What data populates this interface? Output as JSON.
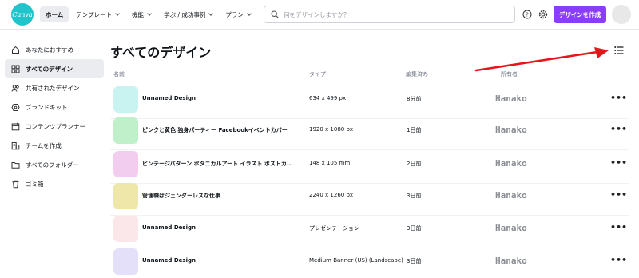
{
  "app": {
    "logo_text": "Canva"
  },
  "nav": {
    "items": [
      {
        "label": "ホーム",
        "active": true,
        "has_chevron": false
      },
      {
        "label": "テンプレート",
        "active": false,
        "has_chevron": true
      },
      {
        "label": "機能",
        "active": false,
        "has_chevron": true
      },
      {
        "label": "学ぶ / 成功事例",
        "active": false,
        "has_chevron": true
      },
      {
        "label": "プラン",
        "active": false,
        "has_chevron": true
      }
    ]
  },
  "search": {
    "placeholder": "何をデザインしますか？"
  },
  "header": {
    "create_label": "デザインを作成"
  },
  "sidebar": {
    "items": [
      {
        "label": "あなたにおすすめ",
        "icon": "home-icon",
        "active": false
      },
      {
        "label": "すべてのデザイン",
        "icon": "grid-icon",
        "active": true
      },
      {
        "label": "共有されたデザイン",
        "icon": "people-icon",
        "active": false
      },
      {
        "label": "ブランドキット",
        "icon": "brand-icon",
        "active": false
      },
      {
        "label": "コンテンツプランナー",
        "icon": "calendar-icon",
        "active": false
      },
      {
        "label": "チームを作成",
        "icon": "building-icon",
        "active": false
      },
      {
        "label": "すべてのフォルダー",
        "icon": "folder-icon",
        "active": false
      },
      {
        "label": "ゴミ箱",
        "icon": "trash-icon",
        "active": false
      }
    ]
  },
  "main": {
    "title": "すべてのデザイン",
    "columns": {
      "name": "名前",
      "type": "タイプ",
      "edited": "編集済み",
      "owner": "所有者"
    },
    "rows": [
      {
        "name": "Unnamed Design",
        "type": "634 x 499 px",
        "edited": "8分前",
        "owner": "Hanako",
        "thumb_color": "#c9f3f1"
      },
      {
        "name": "ピンクと黄色 独身パーティー Facebookイベントカバー",
        "type": "1920 x 1080 px",
        "edited": "1日前",
        "owner": "Hanako",
        "thumb_color": "#bff0c9"
      },
      {
        "name": "ビンテージパターン ボタニカルアート イラスト ポストカ...",
        "type": "148 x 105 mm",
        "edited": "2日前",
        "owner": "Hanako",
        "thumb_color": "#f3cdf0"
      },
      {
        "name": "管理職はジェンダーレスな仕事",
        "type": "2240 x 1260 px",
        "edited": "3日前",
        "owner": "Hanako",
        "thumb_color": "#efe6aa"
      },
      {
        "name": "Unnamed Design",
        "type": "プレゼンテーション",
        "edited": "3日前",
        "owner": "Hanako",
        "thumb_color": "#fbe6ea"
      },
      {
        "name": "Unnamed Design",
        "type": "Medium Banner (US) (Landscape)",
        "edited": "3日前",
        "owner": "Hanako",
        "thumb_color": "#e4e0fa"
      }
    ]
  },
  "annotation": {
    "arrow_color": "#e8141b"
  }
}
